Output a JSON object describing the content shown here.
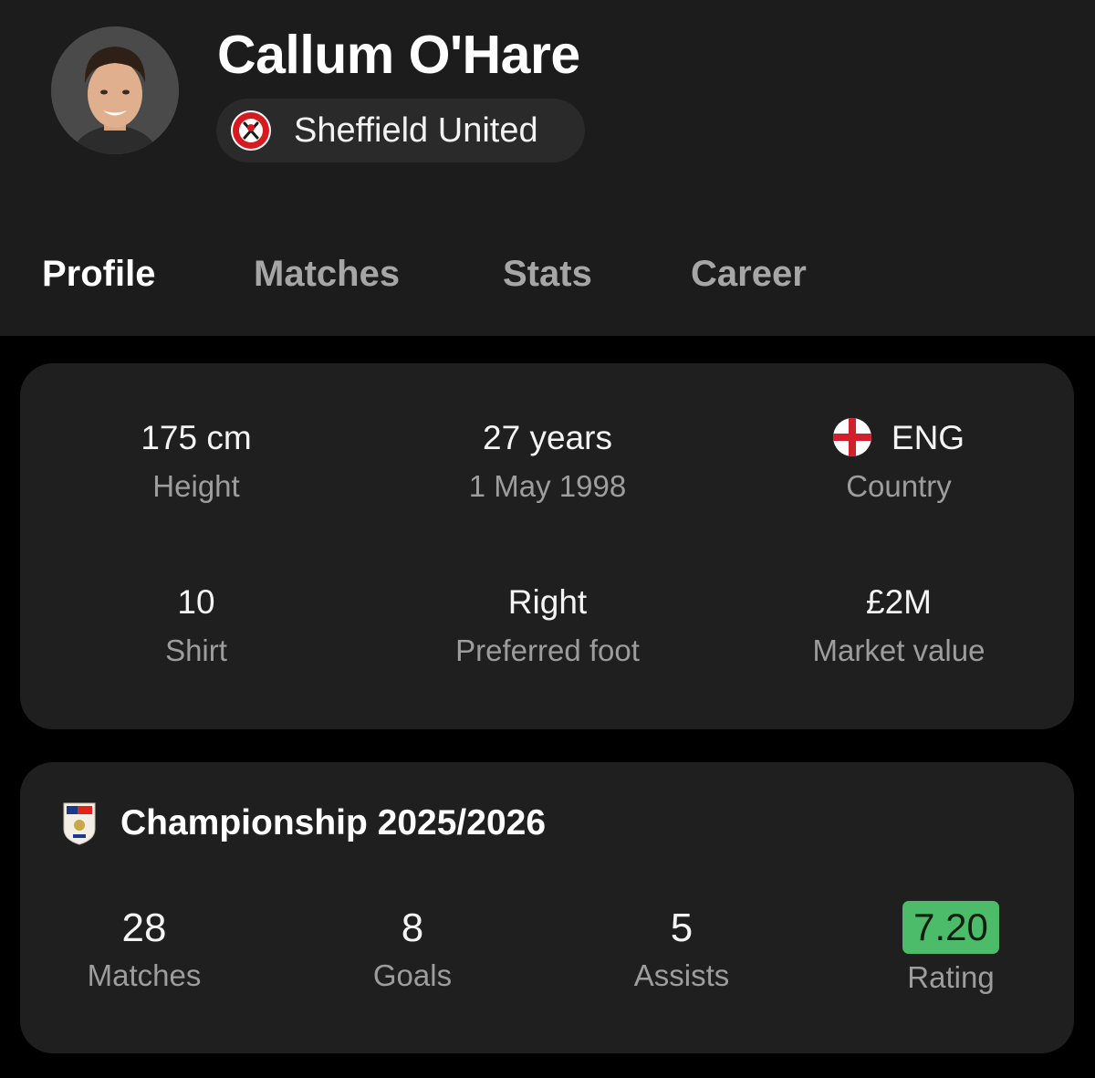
{
  "player": {
    "name": "Callum O'Hare",
    "team": "Sheffield United",
    "avatar_icon": "player-photo",
    "team_crest_icon": "sheffield-united-crest"
  },
  "tabs": [
    {
      "label": "Profile",
      "active": true
    },
    {
      "label": "Matches",
      "active": false
    },
    {
      "label": "Stats",
      "active": false
    },
    {
      "label": "Career",
      "active": false
    }
  ],
  "info": {
    "height": {
      "value": "175 cm",
      "label": "Height"
    },
    "age": {
      "value": "27 years",
      "label": "1 May 1998"
    },
    "country": {
      "value": "ENG",
      "label": "Country",
      "flag_icon": "england-flag-icon"
    },
    "shirt": {
      "value": "10",
      "label": "Shirt"
    },
    "foot": {
      "value": "Right",
      "label": "Preferred foot"
    },
    "market_value": {
      "value": "£2M",
      "label": "Market value"
    }
  },
  "season": {
    "title": "Championship 2025/2026",
    "logo_icon": "efl-championship-logo",
    "stats": {
      "matches": {
        "value": "28",
        "label": "Matches"
      },
      "goals": {
        "value": "8",
        "label": "Goals"
      },
      "assists": {
        "value": "5",
        "label": "Assists"
      },
      "rating": {
        "value": "7.20",
        "label": "Rating"
      }
    }
  },
  "colors": {
    "rating_badge": "#4cbb6a",
    "background": "#000000",
    "card": "#1f1f1f",
    "header": "#1c1c1c",
    "team_red": "#d71920"
  }
}
